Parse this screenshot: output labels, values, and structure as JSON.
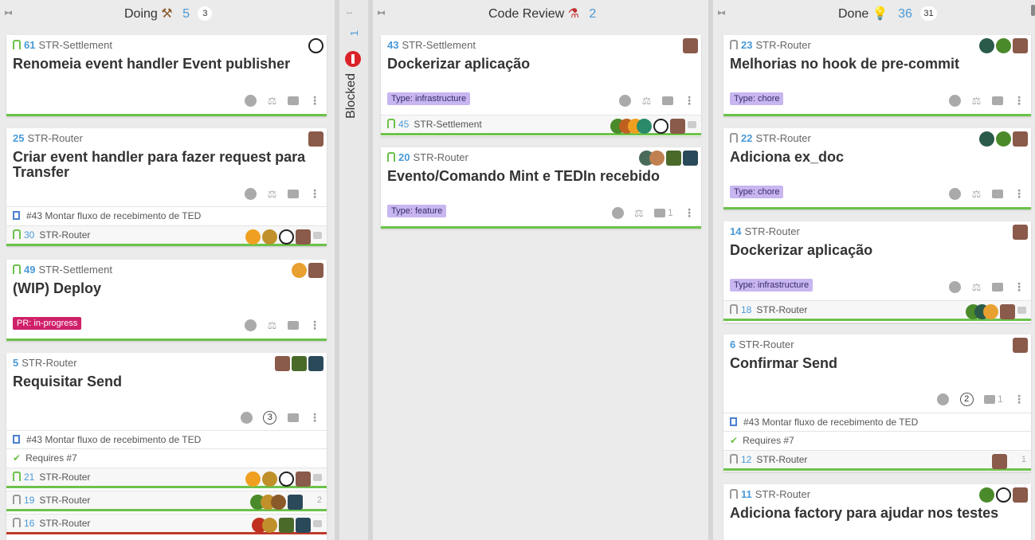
{
  "colors": {
    "green": "#6cc24a",
    "blue": "#4a9ad8",
    "red": "#c0392b",
    "purple_label": "#c8b6f0",
    "wip_label": "#d0206a"
  },
  "columns": {
    "doing": {
      "title": "Doing",
      "icon": "hammer-icon",
      "count": "5",
      "badge": "3"
    },
    "blocked": {
      "title": "Blocked",
      "count": "1",
      "icon": "stop-icon"
    },
    "review": {
      "title": "Code Review",
      "icon": "microscope-icon",
      "count": "2"
    },
    "done": {
      "title": "Done",
      "icon": "lightbulb-icon",
      "count": "36",
      "badge": "31"
    }
  },
  "doing_cards": [
    {
      "num": "61",
      "repo": "STR-Settlement",
      "title": "Renomeia event handler Event publisher"
    },
    {
      "num": "25",
      "repo": "STR-Router",
      "title": "Criar event handler para fazer request para Transfer",
      "epic": "#43 Montar fluxo de recebimento de TED",
      "pr_num": "30",
      "pr_repo": "STR-Router"
    },
    {
      "num": "49",
      "repo": "STR-Settlement",
      "title": "(WIP) Deploy",
      "label": "PR: in-progress"
    },
    {
      "num": "5",
      "repo": "STR-Router",
      "title": "Requisitar Send",
      "circle": "3",
      "epic": "#43 Montar fluxo de recebimento de TED",
      "requires": "Requires #7",
      "prs": [
        {
          "num": "21",
          "repo": "STR-Router"
        },
        {
          "num": "19",
          "repo": "STR-Router",
          "comments": "2"
        },
        {
          "num": "16",
          "repo": "STR-Router"
        }
      ]
    }
  ],
  "review_cards": [
    {
      "num": "43",
      "repo": "STR-Settlement",
      "title": "Dockerizar aplicação",
      "label": "Type: infrastructure",
      "pr_num": "45",
      "pr_repo": "STR-Settlement"
    },
    {
      "num": "20",
      "repo": "STR-Router",
      "title": "Evento/Comando Mint e TEDIn recebido",
      "label": "Type: feature",
      "comments": "1"
    }
  ],
  "done_cards": [
    {
      "num": "23",
      "repo": "STR-Router",
      "title": "Melhorias no hook de pre-commit",
      "label": "Type: chore"
    },
    {
      "num": "22",
      "repo": "STR-Router",
      "title": "Adiciona ex_doc",
      "label": "Type: chore"
    },
    {
      "num": "14",
      "repo": "STR-Router",
      "title": "Dockerizar aplicação",
      "label": "Type: infrastructure",
      "pr_num": "18",
      "pr_repo": "STR-Router"
    },
    {
      "num": "6",
      "repo": "STR-Router",
      "title": "Confirmar Send",
      "circle": "2",
      "comments": "1",
      "epic": "#43 Montar fluxo de recebimento de TED",
      "requires": "Requires #7",
      "pr_num": "12",
      "pr_repo": "STR-Router",
      "pr_comments": "1"
    },
    {
      "num": "11",
      "repo": "STR-Router",
      "title": "Adiciona factory para ajudar nos testes"
    }
  ]
}
